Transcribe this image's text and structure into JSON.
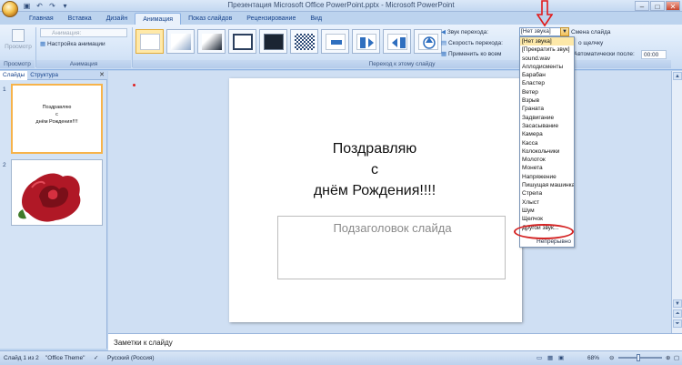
{
  "window": {
    "title": "Презентация Microsoft Office PowerPoint.pptx - Microsoft PowerPoint"
  },
  "tabs": [
    "Главная",
    "Вставка",
    "Дизайн",
    "Анимация",
    "Показ слайдов",
    "Рецензирование",
    "Вид"
  ],
  "ribbon": {
    "preview_label": "Просмотр",
    "preview_group": "Просмотр",
    "animation_combo": "Анимация:",
    "custom_animation": "Настройка анимации",
    "animation_group": "Анимация",
    "transition_group": "Переход к этому слайду",
    "sound_label": "Звук перехода:",
    "sound_value": "[Нет звука]",
    "speed_label": "Скорость перехода:",
    "apply_all": "Применить ко всем",
    "slide_change": "Смена слайда",
    "on_click": "о щелчку",
    "auto_after": "Автоматически после:",
    "auto_time": "00:00"
  },
  "sound_options": [
    "[Нет звука]",
    "[Прекратить звук]",
    "sound.wav",
    "Аплодисменты",
    "Барабан",
    "Бластер",
    "Ветер",
    "Взрыв",
    "Граната",
    "Задвигание",
    "Засасывание",
    "Камера",
    "Касса",
    "Колокольчики",
    "Молоток",
    "Монета",
    "Напряжение",
    "Пишущая машинка",
    "Стрела",
    "Хлыст",
    "Шум",
    "Щелчок",
    "Другой звук..."
  ],
  "sound_continuous": "Непрерывно",
  "left_panel": {
    "tab_slides": "Слайды",
    "tab_outline": "Структура",
    "slide1_num": "1",
    "slide1_text": "Поздравляю\nс\nднём Рождения!!!!",
    "slide2_num": "2"
  },
  "slide": {
    "title": "Поздравляю\nс\nднём Рождения!!!!",
    "subtitle_placeholder": "Подзаголовок слайда"
  },
  "notes_placeholder": "Заметки к слайду",
  "status": {
    "slide_info": "Слайд 1 из 2",
    "theme": "\"Office Theme\"",
    "language": "Русский (Россия)",
    "zoom": "68%"
  },
  "colors": {
    "accent": "#f7b34a",
    "highlight_ellipse": "#d42424"
  }
}
